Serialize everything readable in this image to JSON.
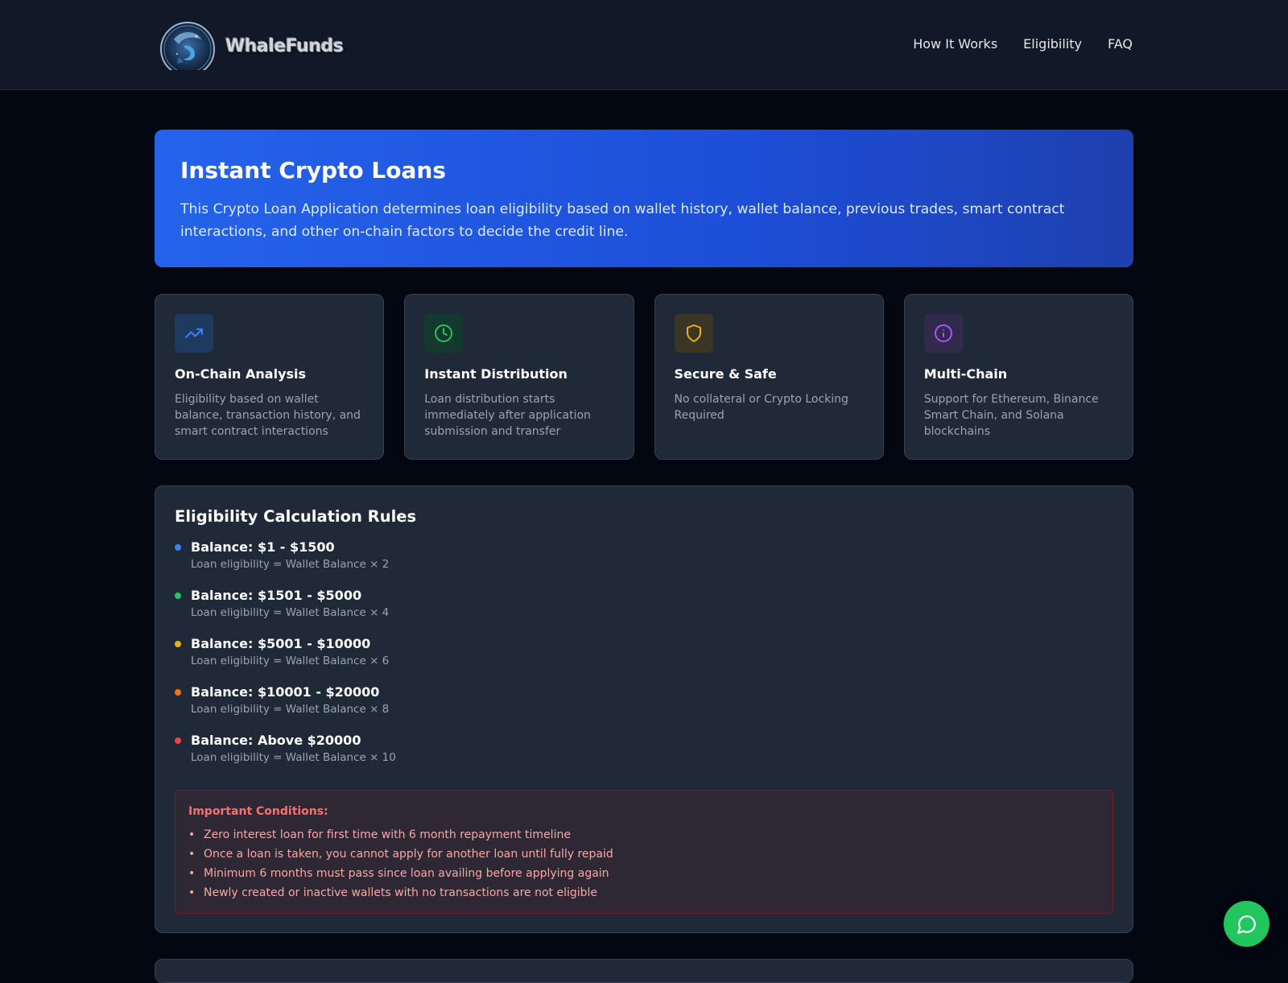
{
  "header": {
    "brand": "WhaleFunds",
    "nav": [
      {
        "label": "How It Works"
      },
      {
        "label": "Eligibility"
      },
      {
        "label": "FAQ"
      }
    ]
  },
  "hero": {
    "title": "Instant Crypto Loans",
    "description": "This Crypto Loan Application determines loan eligibility based on wallet history, wallet balance, previous trades, smart contract interactions, and other on-chain factors to decide the credit line."
  },
  "features": [
    {
      "icon": "trending-up-icon",
      "color": "#3b82f6",
      "bg": "#1e3a5f",
      "title": "On-Chain Analysis",
      "text": "Eligibility based on wallet balance, transaction history, and smart contract interactions"
    },
    {
      "icon": "clock-icon",
      "color": "#22c55e",
      "bg": "#14392e",
      "title": "Instant Distribution",
      "text": "Loan distribution starts immediately after application submission and transfer"
    },
    {
      "icon": "shield-icon",
      "color": "#eab308",
      "bg": "#3a3524",
      "title": "Secure & Safe",
      "text": "No collateral or Crypto Locking Required"
    },
    {
      "icon": "info-icon",
      "color": "#a855f7",
      "bg": "#312a4d",
      "title": "Multi-Chain",
      "text": "Support for Ethereum, Binance Smart Chain, and Solana blockchains"
    }
  ],
  "rules": {
    "title": "Eligibility Calculation Rules",
    "items": [
      {
        "color": "#3b82f6",
        "title": "Balance: $1 - $1500",
        "desc": "Loan eligibility = Wallet Balance × 2"
      },
      {
        "color": "#22c55e",
        "title": "Balance: $1501 - $5000",
        "desc": "Loan eligibility = Wallet Balance × 4"
      },
      {
        "color": "#eab308",
        "title": "Balance: $5001 - $10000",
        "desc": "Loan eligibility = Wallet Balance × 6"
      },
      {
        "color": "#f97316",
        "title": "Balance: $10001 - $20000",
        "desc": "Loan eligibility = Wallet Balance × 8"
      },
      {
        "color": "#ef4444",
        "title": "Balance: Above $20000",
        "desc": "Loan eligibility = Wallet Balance × 10"
      }
    ],
    "conditions": {
      "title": "Important Conditions:",
      "items": [
        "Zero interest loan for first time with 6 month repayment timeline",
        "Once a loan is taken, you cannot apply for another loan until fully repaid",
        "Minimum 6 months must pass since loan availing before applying again",
        "Newly created or inactive wallets with no transactions are not eligible"
      ]
    }
  },
  "chat": {
    "icon": "chat-bubble-icon"
  }
}
